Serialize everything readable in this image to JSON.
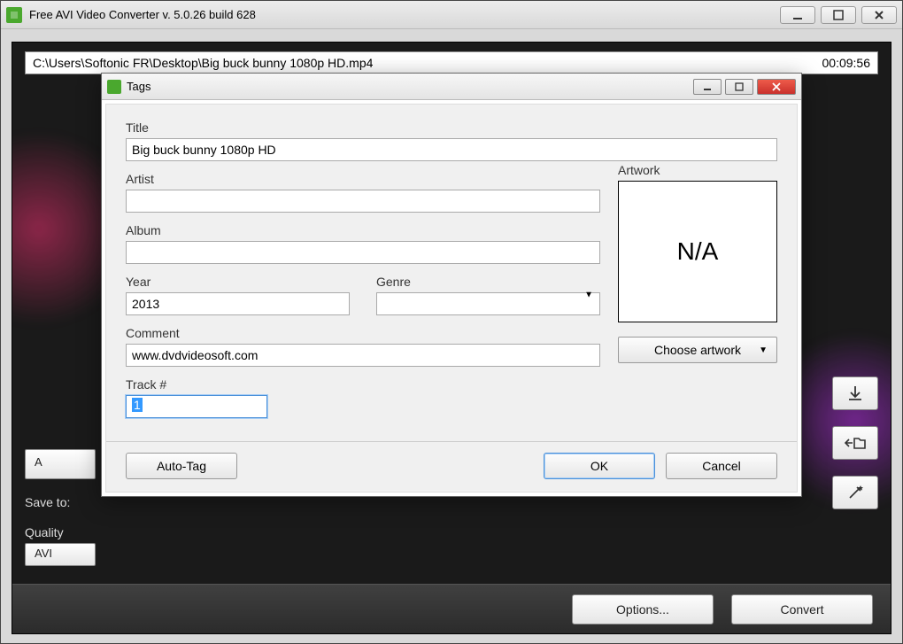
{
  "outer": {
    "title": "Free AVI Video Converter  v. 5.0.26 build 628",
    "file_path": "C:\\Users\\Softonic FR\\Desktop\\Big buck bunny 1080p HD.mp4",
    "duration": "00:09:56",
    "add_label": "A",
    "save_to_label": "Save to:",
    "quality_label": "Quality",
    "format_value": "AVI",
    "options_label": "Options...",
    "convert_label": "Convert"
  },
  "dialog": {
    "title": "Tags",
    "labels": {
      "title": "Title",
      "artist": "Artist",
      "album": "Album",
      "year": "Year",
      "genre": "Genre",
      "comment": "Comment",
      "track": "Track #",
      "artwork": "Artwork"
    },
    "values": {
      "title": "Big buck bunny 1080p HD",
      "artist": "",
      "album": "",
      "year": "2013",
      "genre": "",
      "comment": "www.dvdvideosoft.com",
      "track": "1",
      "artwork": "N/A"
    },
    "buttons": {
      "choose_artwork": "Choose artwork",
      "auto_tag": "Auto-Tag",
      "ok": "OK",
      "cancel": "Cancel"
    }
  }
}
